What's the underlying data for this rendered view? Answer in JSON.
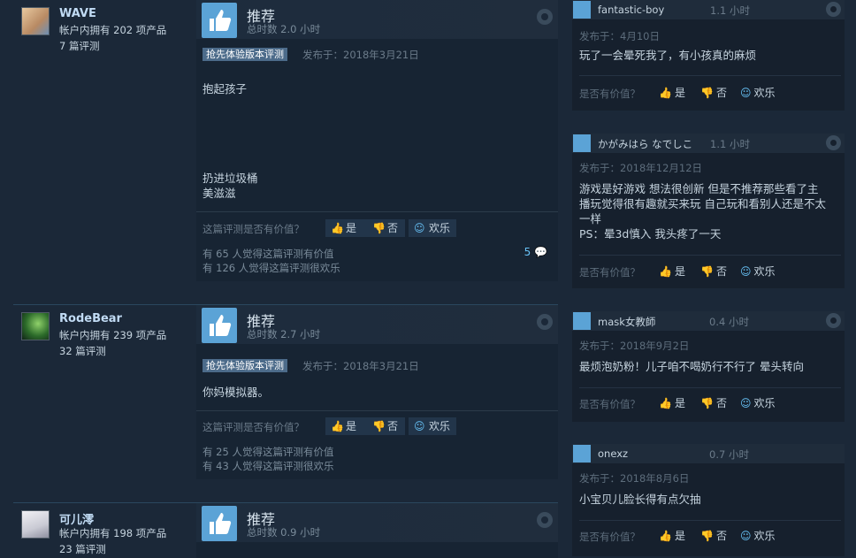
{
  "labels": {
    "recommended": "推荐",
    "early_access": "抢先体验版本评测",
    "helpful_question": "这篇评测是否有价值？",
    "yes": "是",
    "no": "否",
    "funny": "欢乐",
    "rc_helpful_question": "是否有价值？"
  },
  "reviews": [
    {
      "name": "WAVE",
      "owned": "帐户内拥有 202 项产品",
      "review_count": "7 篇评测",
      "hours": "总时数 2.0 小时",
      "posted": "发布于：2018年3月21日",
      "text1": "抱起孩子",
      "text2": "扔进垃圾桶",
      "text3": "美滋滋",
      "helpful_stat": "有 65 人觉得这篇评测有价值",
      "funny_stat": "有 126 人觉得这篇评测很欢乐",
      "comments": "5"
    },
    {
      "name": "RodeBear",
      "owned": "帐户内拥有 239 项产品",
      "review_count": "32 篇评测",
      "hours": "总时数 2.7 小时",
      "posted": "发布于：2018年3月21日",
      "text1": "你妈模拟器。",
      "helpful_stat": "有 25 人觉得这篇评测有价值",
      "funny_stat": "有 43 人觉得这篇评测很欢乐"
    },
    {
      "name": "可儿澪",
      "owned": "帐户内拥有 198 项产品",
      "review_count": "23 篇评测",
      "hours": "总时数 0.9 小时"
    }
  ],
  "side_reviews": [
    {
      "user": "fantastic-boy",
      "hours": "1.1 小时",
      "posted": "发布于：4月10日",
      "text": "玩了一会晕死我了，有小孩真的麻烦"
    },
    {
      "user": "かがみはら なでしこ",
      "hours": "1.1 小时",
      "posted": "发布于：2018年12月12日",
      "line1": "游戏是好游戏 想法很创新 但是不推荐那些看了主",
      "line2": "播玩觉得很有趣就买来玩 自己玩和看别人还是不太",
      "line3": "一样",
      "line4": "PS：晕3d慎入 我头疼了一天"
    },
    {
      "user": "mask女教師",
      "hours": "0.4 小时",
      "posted": "发布于：2018年9月2日",
      "text": "最烦泡奶粉！儿子咱不喝奶行不行了 晕头转向"
    },
    {
      "user": "onexz",
      "hours": "0.7 小时",
      "posted": "发布于：2018年8月6日",
      "text": "小宝贝儿脸长得有点欠抽"
    }
  ],
  "colors": {
    "background": "#1b2838",
    "accent": "#67c1f5",
    "thumb": "#5ba3d6"
  }
}
